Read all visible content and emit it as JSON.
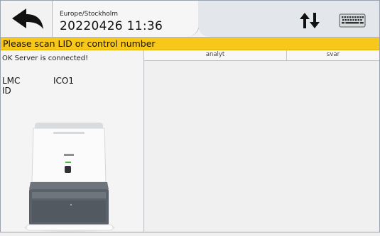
{
  "header": {
    "back_icon": "arrow-left-icon",
    "timezone": "Europe/Stockholm",
    "datetime": "20220426 11:36",
    "swap_icon": "up-down-arrows-icon",
    "keyboard_icon": "keyboard-icon"
  },
  "banner": {
    "text": "Please scan LID or control number",
    "color": "#f7c81a"
  },
  "left_panel": {
    "status": "OK Server is connected!",
    "lmc_label": "LMC",
    "lmc_value": "ICO1",
    "id_label": "ID",
    "device_image": "analyzer-device-image"
  },
  "results_table": {
    "columns": [
      "analyt",
      "svar"
    ],
    "rows": []
  }
}
